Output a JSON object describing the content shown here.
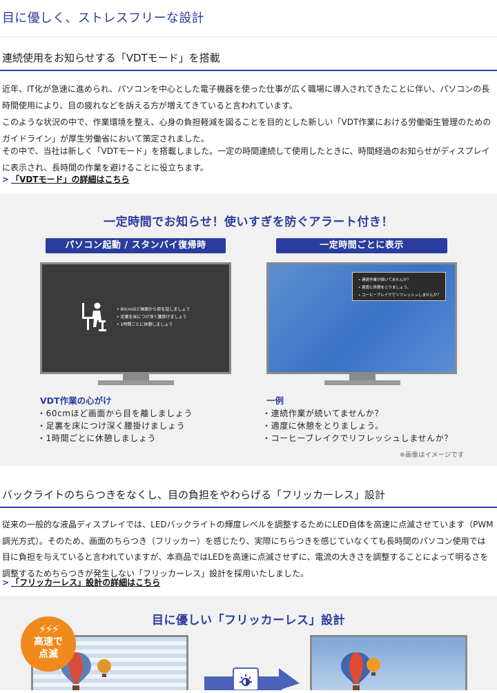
{
  "page_title": "目に優しく、ストレスフリーな設計",
  "vdt": {
    "heading": "連続使用をお知らせする「VDTモード」を搭載",
    "para1": "近年、IT化が急速に進められ、パソコンを中心とした電子機器を使った仕事が広く職場に導入されてきたことに伴い、パソコンの長時間使用により、目の疲れなどを訴える方が増えてきていると言われています。",
    "para2": "このような状況の中で、作業環境を整え、心身の負担軽減を図ることを目的とした新しい「VDT作業における労働衛生管理のためのガイドライン」が厚生労働省において策定されました。",
    "para3": "その中で、当社は新しく「VDTモード」を搭載しました。一定の時間連続して使用したときに、時間経過のお知らせがディスプレイに表示され、長時間の作業を避けることに役立ちます。",
    "link_label": "「VDTモード」の詳細はこちら",
    "link_arrow": ">"
  },
  "vdt_panel": {
    "title": "一定時間でお知らせ！使いすぎを防ぐアラート付き！",
    "left_pill": "パソコン起動 / スタンバイ復帰時",
    "right_pill": "一定時間ごとに表示",
    "left_screen_items": [
      "60cmほど画面から目を話しましょう",
      "足裏を床につけ深く腰掛けましょう",
      "1時間ごとに休憩しましょう"
    ],
    "right_screen_items": [
      "連続作業が続いてませんか？",
      "適度に休憩をとりましょう。",
      "コーヒーブレイクでリフレッシュしませんか？"
    ],
    "left_caption_title": "VDT作業の心がけ",
    "left_caption_items": [
      "60cmほど画面から目を離しましょう",
      "足裏を床につけ深く腰掛けましょう",
      "1時間ごとに休憩しましょう"
    ],
    "right_caption_title": "一例",
    "right_caption_items": [
      "連続作業が続いてませんか？",
      "適度に休憩をとりましょう。",
      "コーヒーブレイクでリフレッシュしませんか？"
    ],
    "note": "※画像はイメージです"
  },
  "flicker": {
    "heading": "バックライトのちらつきをなくし、目の負担をやわらげる「フリッカーレス」設計",
    "para": "従来の一般的な液晶ディスプレイでは、LEDバックライトの輝度レベルを調整するためにLED自体を高速に点滅させています（PWM調光方式）。そのため、画面のちらつき（フリッカー）を感じたり、実際にちらつきを感じていなくても長時間のパソコン使用では目に負担を与えていると言われていますが、本商品ではLEDを高速に点滅させずに、電流の大きさを調整することによって明るさを調整するためちらつきが発生しない「フリッカーレス」設計を採用いたしました。",
    "link_label": "「フリッカーレス」設計の詳細はこちら",
    "link_arrow": ">",
    "panel_title": "目に優しい「フリッカーレス」設計",
    "badge_line1": "高速で",
    "badge_line2": "点滅",
    "badge_bolts": "⚡⚡⚡"
  },
  "colors": {
    "accent": "#2a3d9e",
    "badge": "#f08a1c",
    "panel_bg": "#f1f1f1"
  }
}
